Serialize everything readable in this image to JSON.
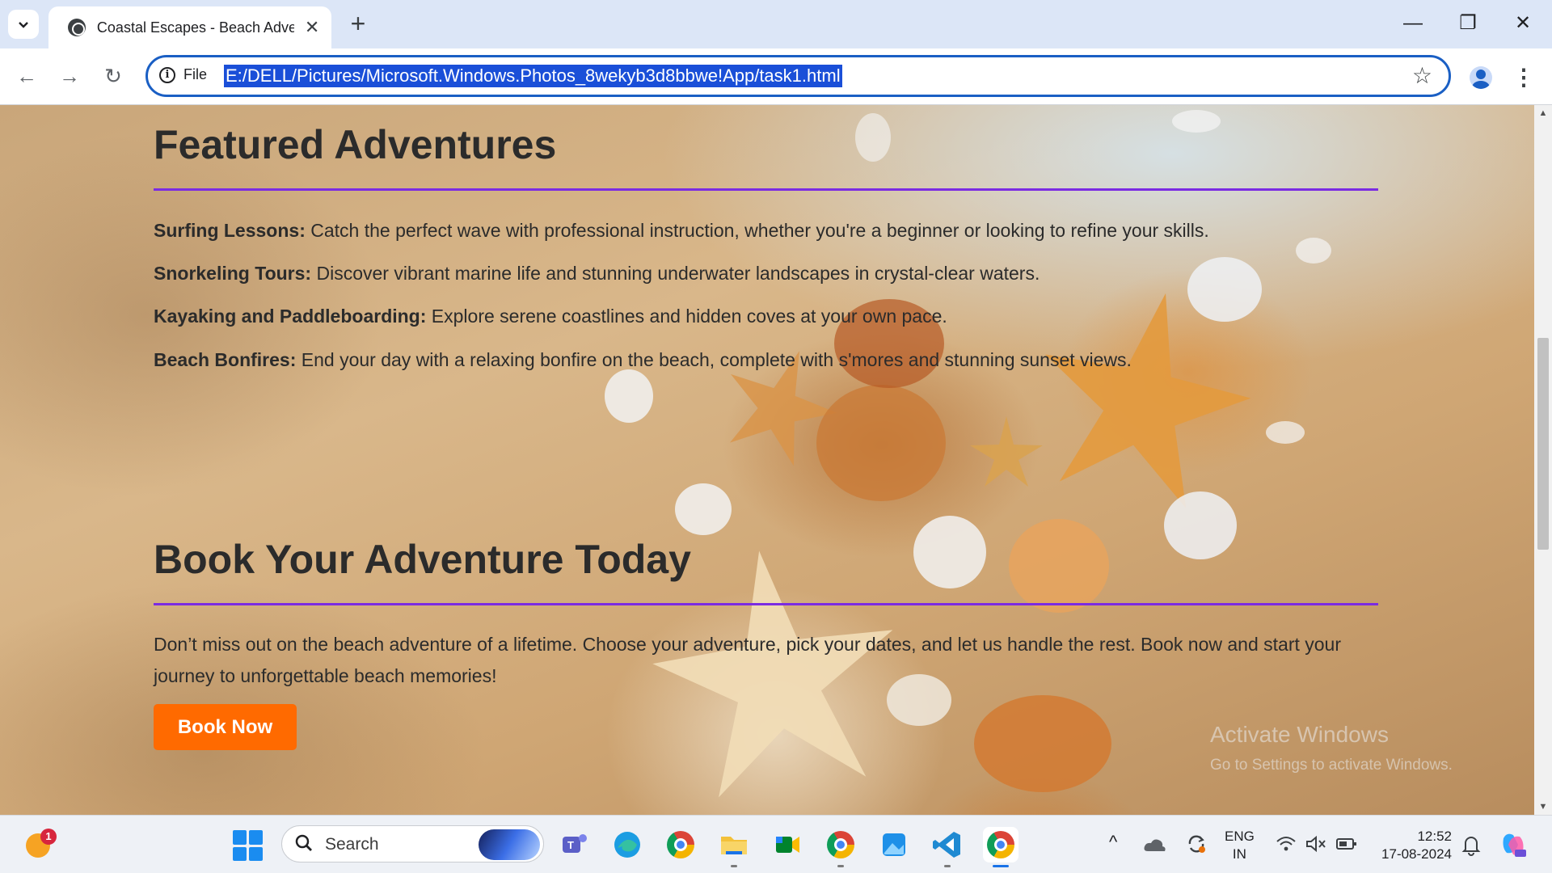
{
  "browser": {
    "tab_title": "Coastal Escapes - Beach Adventures",
    "tab_search_icon": "chevron-down-icon",
    "new_tab_label": "+",
    "minimize_label": "—",
    "restore_label": "❐",
    "close_label": "✕",
    "back_label": "←",
    "forward_label": "→",
    "reload_label": "↻",
    "site_info_label": "File",
    "url": "E:/DELL/Pictures/Microsoft.Windows.Photos_8wekyb3d8bbwe!App/task1.html",
    "bookmark_label": "☆",
    "menu_label": "⋮"
  },
  "page": {
    "featured_title": "Featured Adventures",
    "features": [
      {
        "name": "Surfing Lessons:",
        "text": " Catch the perfect wave with professional instruction, whether you're a beginner or looking to refine your skills."
      },
      {
        "name": "Snorkeling Tours:",
        "text": " Discover vibrant marine life and stunning underwater landscapes in crystal-clear waters."
      },
      {
        "name": "Kayaking and Paddleboarding:",
        "text": " Explore serene coastlines and hidden coves at your own pace."
      },
      {
        "name": "Beach Bonfires:",
        "text": " End your day with a relaxing bonfire on the beach, complete with s'mores and stunning sunset views."
      }
    ],
    "book_title": "Book Your Adventure Today",
    "book_text": "Don’t miss out on the beach adventure of a lifetime. Choose your adventure, pick your dates, and let us handle the rest. Book now and start your journey to unforgettable beach memories!",
    "book_button": "Book Now",
    "accent_color": "#7b2be2",
    "button_color": "#ff6a00"
  },
  "watermark": {
    "title": "Activate Windows",
    "subtitle": "Go to Settings to activate Windows."
  },
  "scrollbar": {
    "up_label": "▲",
    "down_label": "▼"
  },
  "taskbar": {
    "weather_badge": "1",
    "search_label": "Search",
    "apps": [
      "teams-icon",
      "edge-icon",
      "chrome-icon",
      "file-explorer-icon",
      "meet-icon",
      "chrome-icon",
      "photos-icon",
      "vscode-icon",
      "chrome-icon"
    ],
    "tray_chevron": "^",
    "lang_line1": "ENG",
    "lang_line2": "IN",
    "time": "12:52",
    "date": "17-08-2024"
  }
}
